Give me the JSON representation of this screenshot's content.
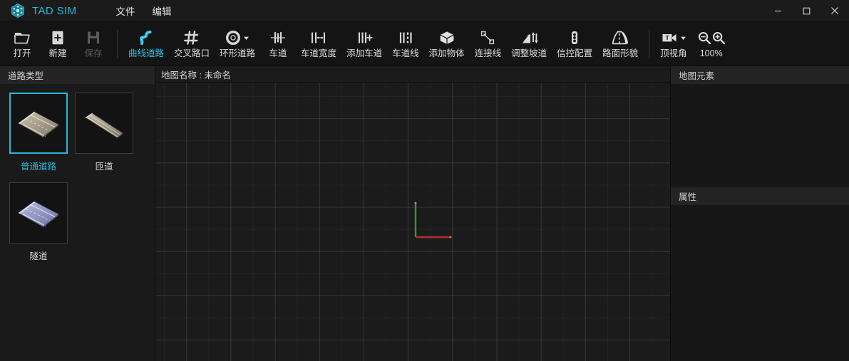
{
  "app": {
    "title": "TAD SIM",
    "logo_icon": "tadsim-logo-icon"
  },
  "titlebar": {
    "menus": [
      {
        "label": "文件",
        "name": "menu-file"
      },
      {
        "label": "编辑",
        "name": "menu-edit"
      }
    ],
    "window_controls": [
      {
        "name": "minimize-button",
        "icon": "minimize-icon"
      },
      {
        "name": "maximize-button",
        "icon": "maximize-icon"
      },
      {
        "name": "close-button",
        "icon": "close-icon"
      }
    ]
  },
  "toolbar": {
    "groups": [
      {
        "items": [
          {
            "label": "打开",
            "icon": "open-folder-icon",
            "state": "normal"
          },
          {
            "label": "新建",
            "icon": "new-file-icon",
            "state": "normal"
          },
          {
            "label": "保存",
            "icon": "save-disk-icon",
            "state": "disabled"
          }
        ]
      },
      {
        "items": [
          {
            "label": "曲线道路",
            "icon": "curve-road-icon",
            "state": "active"
          },
          {
            "label": "交叉路口",
            "icon": "intersection-icon",
            "state": "normal"
          },
          {
            "label": "环形道路",
            "icon": "roundabout-icon",
            "state": "normal",
            "caret": true
          },
          {
            "label": "车道",
            "icon": "lane-icon",
            "state": "normal"
          },
          {
            "label": "车道宽度",
            "icon": "lane-width-icon",
            "state": "normal"
          },
          {
            "label": "添加车道",
            "icon": "add-lane-icon",
            "state": "normal"
          },
          {
            "label": "车道线",
            "icon": "lane-line-icon",
            "state": "normal"
          },
          {
            "label": "添加物体",
            "icon": "add-object-icon",
            "state": "normal"
          },
          {
            "label": "连接线",
            "icon": "connection-line-icon",
            "state": "normal"
          },
          {
            "label": "调整坡道",
            "icon": "adjust-ramp-icon",
            "state": "normal"
          },
          {
            "label": "信控配置",
            "icon": "traffic-light-icon",
            "state": "normal"
          },
          {
            "label": "路面形貌",
            "icon": "road-surface-icon",
            "state": "normal"
          }
        ]
      },
      {
        "items": [
          {
            "label": "顶视角",
            "icon": "top-view-camera-icon",
            "state": "normal",
            "caret": true
          },
          {
            "label": "100%",
            "icon": "zoom-controls-icon",
            "state": "normal"
          }
        ]
      }
    ]
  },
  "left_panel": {
    "header": "道路类型",
    "road_types": [
      {
        "label": "普通道路",
        "name": "road-type-normal",
        "selected": true,
        "thumb": "normal-road-thumb"
      },
      {
        "label": "匝道",
        "name": "road-type-ramp",
        "selected": false,
        "thumb": "ramp-road-thumb"
      },
      {
        "label": "隧道",
        "name": "road-type-tunnel",
        "selected": false,
        "thumb": "tunnel-road-thumb"
      }
    ]
  },
  "viewport": {
    "map_name_label": "地图名称 : 未命名",
    "gizmo": {
      "x_axis_color": "#b03030",
      "y_axis_color": "#2f9c36"
    }
  },
  "right_panel": {
    "map_elements_header": "地图元素",
    "properties_header": "属性"
  },
  "colors": {
    "accent": "#29b6d8",
    "toolbar_active": "#2fc3e8",
    "titlebar_bg": "#1b1b1b",
    "panel_bg": "#1a1a1a",
    "panel_header_bg": "#242424",
    "canvas_bg": "#1b1b1b"
  }
}
